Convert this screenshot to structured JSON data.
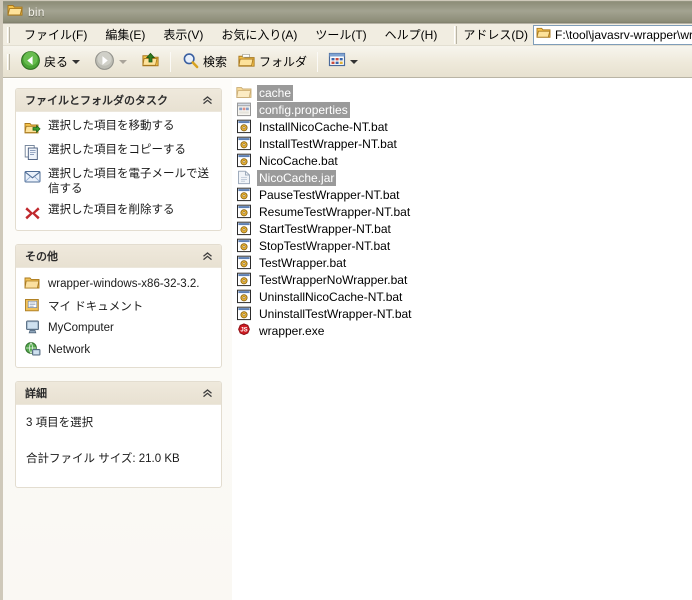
{
  "window": {
    "title": "bin",
    "title_icon": "folder-open-icon"
  },
  "menubar": {
    "items": [
      {
        "label": "ファイル(F)",
        "accel": "F"
      },
      {
        "label": "編集(E)",
        "accel": "E"
      },
      {
        "label": "表示(V)",
        "accel": "V"
      },
      {
        "label": "お気に入り(A)",
        "accel": "A"
      },
      {
        "label": "ツール(T)",
        "accel": "T"
      },
      {
        "label": "ヘルプ(H)",
        "accel": "H"
      }
    ]
  },
  "address": {
    "label": "アドレス(D)",
    "value": "F:\\tool\\javasrv-wrapper\\wrapper-windows-x",
    "icon": "folder-icon"
  },
  "toolbar": {
    "back_label": "戻る",
    "back_icon": "back-arrow-icon",
    "forward_label": "",
    "forward_icon": "forward-arrow-icon",
    "up_label": "",
    "up_icon": "up-folder-icon",
    "search_label": "検索",
    "search_icon": "magnifier-icon",
    "folders_label": "フォルダ",
    "folders_icon": "folders-icon",
    "views_icon": "views-icon"
  },
  "sidebar": {
    "panels": [
      {
        "id": "tasks",
        "title": "ファイルとフォルダのタスク",
        "collapse_icon": "chevron-up-icon",
        "items": [
          {
            "label": "選択した項目を移動する",
            "icon": "move-item-icon"
          },
          {
            "label": "選択した項目をコピーする",
            "icon": "copy-item-icon"
          },
          {
            "label": "選択した項目を電子メールで送信する",
            "icon": "email-item-icon"
          },
          {
            "label": "選択した項目を削除する",
            "icon": "delete-item-icon"
          }
        ]
      },
      {
        "id": "other-places",
        "title": "その他",
        "collapse_icon": "chevron-up-icon",
        "items": [
          {
            "label": "wrapper-windows-x86-32-3.2.",
            "icon": "folder-icon"
          },
          {
            "label": "マイ ドキュメント",
            "icon": "my-documents-icon"
          },
          {
            "label": "MyComputer",
            "icon": "my-computer-icon"
          },
          {
            "label": "Network",
            "icon": "network-icon"
          }
        ]
      },
      {
        "id": "details",
        "title": "詳細",
        "collapse_icon": "chevron-up-icon",
        "lines": [
          "3 項目を選択",
          "合計ファイル サイズ: 21.0 KB"
        ]
      }
    ]
  },
  "filelist": {
    "items": [
      {
        "name": "cache",
        "icon": "folder-icon",
        "selected": true
      },
      {
        "name": "config.properties",
        "icon": "properties-file-icon",
        "selected": true
      },
      {
        "name": "InstallNicoCache-NT.bat",
        "icon": "bat-file-icon",
        "selected": false
      },
      {
        "name": "InstallTestWrapper-NT.bat",
        "icon": "bat-file-icon",
        "selected": false
      },
      {
        "name": "NicoCache.bat",
        "icon": "bat-file-icon",
        "selected": false
      },
      {
        "name": "NicoCache.jar",
        "icon": "jar-file-icon",
        "selected": true
      },
      {
        "name": "PauseTestWrapper-NT.bat",
        "icon": "bat-file-icon",
        "selected": false
      },
      {
        "name": "ResumeTestWrapper-NT.bat",
        "icon": "bat-file-icon",
        "selected": false
      },
      {
        "name": "StartTestWrapper-NT.bat",
        "icon": "bat-file-icon",
        "selected": false
      },
      {
        "name": "StopTestWrapper-NT.bat",
        "icon": "bat-file-icon",
        "selected": false
      },
      {
        "name": "TestWrapper.bat",
        "icon": "bat-file-icon",
        "selected": false
      },
      {
        "name": "TestWrapperNoWrapper.bat",
        "icon": "bat-file-icon",
        "selected": false
      },
      {
        "name": "UninstallNicoCache-NT.bat",
        "icon": "bat-file-icon",
        "selected": false
      },
      {
        "name": "UninstallTestWrapper-NT.bat",
        "icon": "bat-file-icon",
        "selected": false
      },
      {
        "name": "wrapper.exe",
        "icon": "wrapper-exe-icon",
        "selected": false
      }
    ]
  },
  "colors": {
    "titlebar": "#9a9a86",
    "selection": "#9a9a9a",
    "panel_header": "#ece6d8",
    "toolbar": "#efe9da",
    "delete_red": "#c0282d",
    "folder_yellow": "#fcd77f"
  }
}
